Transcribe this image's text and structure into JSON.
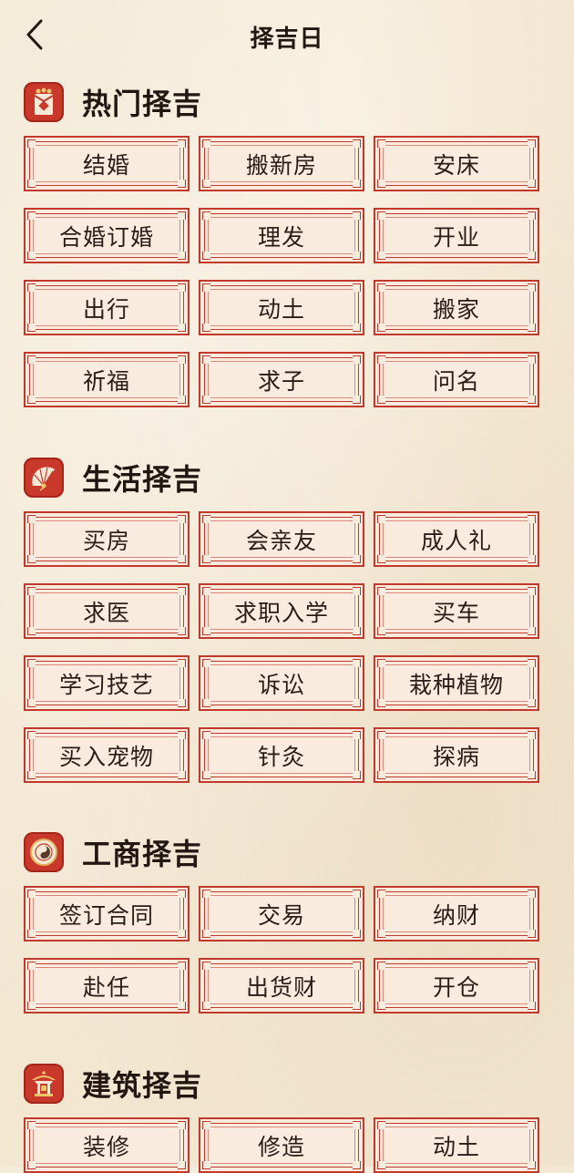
{
  "header": {
    "title": "择吉日",
    "back_icon": "chevron-left-icon"
  },
  "colors": {
    "accent": "#c2392c",
    "background": "#f3e7d2",
    "tag_fill": "#f9ecde",
    "text": "#2a1c16"
  },
  "sections": [
    {
      "title": "热门择吉",
      "icon": "red-envelope-icon",
      "items": [
        "结婚",
        "搬新房",
        "安床",
        "合婚订婚",
        "理发",
        "开业",
        "出行",
        "动土",
        "搬家",
        "祈福",
        "求子",
        "问名"
      ]
    },
    {
      "title": "生活择吉",
      "icon": "fan-icon",
      "items": [
        "买房",
        "会亲友",
        "成人礼",
        "求医",
        "求职入学",
        "买车",
        "学习技艺",
        "诉讼",
        "栽种植物",
        "买入宠物",
        "针灸",
        "探病"
      ]
    },
    {
      "title": "工商择吉",
      "icon": "bagua-compass-icon",
      "items": [
        "签订合同",
        "交易",
        "纳财",
        "赴任",
        "出货财",
        "开仓"
      ]
    },
    {
      "title": "建筑择吉",
      "icon": "pavilion-icon",
      "items": [
        "装修",
        "修造",
        "动土"
      ]
    }
  ]
}
